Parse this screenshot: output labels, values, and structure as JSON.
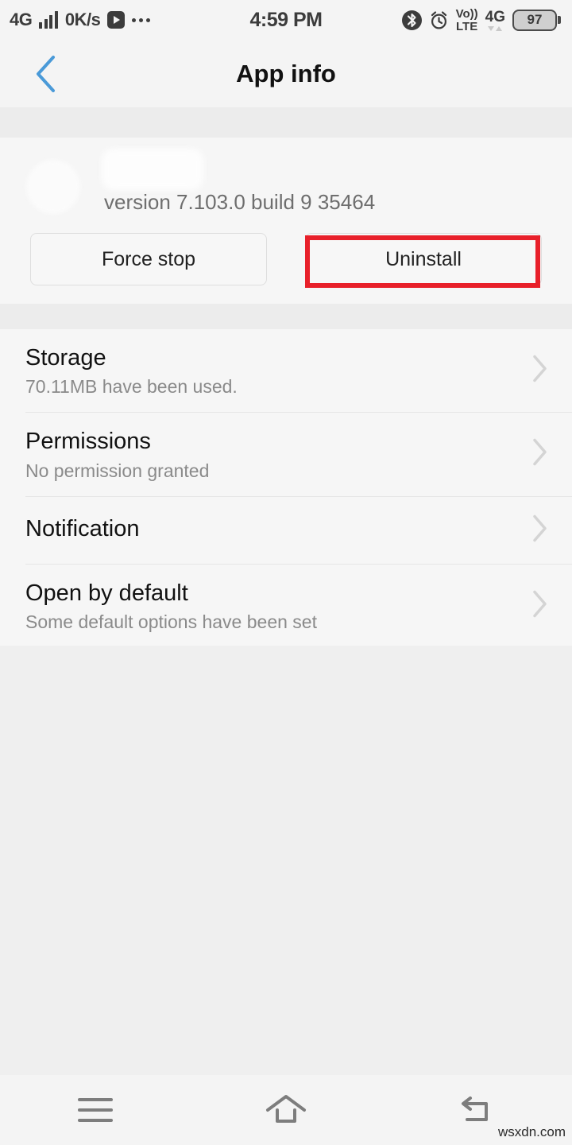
{
  "status_bar": {
    "network_label": "4G",
    "data_rate": "0K/s",
    "play_icon": "play-icon",
    "overflow_icon": "more-dots-icon",
    "clock": "4:59 PM",
    "bluetooth_icon": "bluetooth-icon",
    "alarm_icon": "alarm-clock-icon",
    "volte_line1": "Vo))",
    "volte_line2": "LTE",
    "network_right": "4G",
    "battery_level": "97"
  },
  "header": {
    "title": "App info",
    "back_icon": "chevron-left-icon",
    "back_color": "#4a9ad8"
  },
  "app": {
    "icon": "app-icon-redacted",
    "name_redacted": "app-name-redacted",
    "version": "version 7.103.0 build 9 35464"
  },
  "actions": {
    "force_stop_label": "Force stop",
    "uninstall_label": "Uninstall",
    "highlight_color": "#e8202a",
    "highlight_target": "Uninstall"
  },
  "settings_list": [
    {
      "title": "Storage",
      "subtitle": "70.11MB have been used.",
      "chevron": "chevron-right-icon"
    },
    {
      "title": "Permissions",
      "subtitle": "No permission granted",
      "chevron": "chevron-right-icon"
    },
    {
      "title": "Notification",
      "subtitle": "",
      "chevron": "chevron-right-icon"
    },
    {
      "title": "Open by default",
      "subtitle": "Some default options have been set",
      "chevron": "chevron-right-icon"
    }
  ],
  "navigation_bar": {
    "menu_icon": "menu-icon",
    "home_icon": "home-icon",
    "back_icon": "back-arrow-icon"
  },
  "watermark": "wsxdn.com"
}
